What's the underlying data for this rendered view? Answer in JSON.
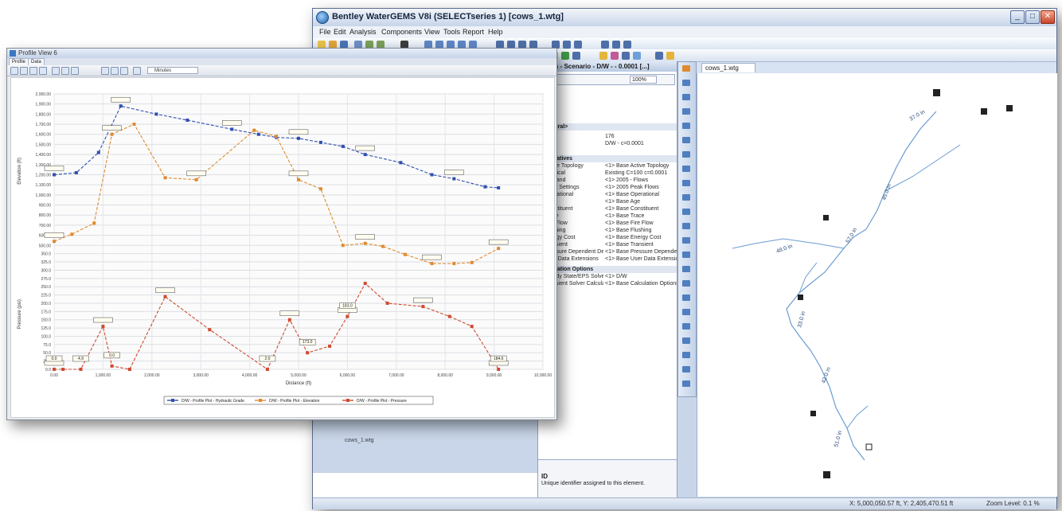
{
  "main_window": {
    "title": "Bentley WaterGEMS V8i (SELECTseries 1) [cows_1.wtg]",
    "menu": [
      "File",
      "Edit",
      "Analysis",
      "Components",
      "View",
      "Tools",
      "Report",
      "Help"
    ],
    "drawing_tab": "cows_1.wtg",
    "zoom_combo": "100%",
    "properties_title": "Pipes - Scenario - D/W - - 0.0001 [...]",
    "properties": {
      "general_header": "<General>",
      "id_value": "176",
      "label_value": "D/W - c=0.0001",
      "scenarios_header": "Alternatives",
      "rows": [
        {
          "name": "Active Topology",
          "value": "<1> Base Active Topology"
        },
        {
          "name": "Physical",
          "value": "Existing C=100 c=0.0001"
        },
        {
          "name": "Demand",
          "value": "<1> 2005 - Flows"
        },
        {
          "name": "Initial Settings",
          "value": "<1> 2005 Peak Flows"
        },
        {
          "name": "Operational",
          "value": "<1> Base Operational"
        },
        {
          "name": "Age",
          "value": "<1> Base Age"
        },
        {
          "name": "Constituent",
          "value": "<1> Base Constituent"
        },
        {
          "name": "Trace",
          "value": "<1> Base Trace"
        },
        {
          "name": "Fire Flow",
          "value": "<1> Base Fire Flow"
        },
        {
          "name": "Flushing",
          "value": "<1> Base Flushing"
        },
        {
          "name": "Energy Cost",
          "value": "<1> Base Energy Cost"
        },
        {
          "name": "Transient",
          "value": "<1> Base Transient"
        },
        {
          "name": "Pressure Dependent Dem",
          "value": "<1> Base Pressure Dependent D"
        },
        {
          "name": "User Data Extensions",
          "value": "<1> Base User Data Extensions"
        }
      ],
      "calc_header": "Calculation Options",
      "calc_rows": [
        {
          "name": "Steady State/EPS Solver",
          "value": "<1> D/W"
        },
        {
          "name": "Transient Solver Calculat",
          "value": "<1> Base Calculation Options"
        }
      ],
      "desc_title": "ID",
      "desc_text": "Unique identifier assigned to this element."
    },
    "left_pane_label": "cows_1.wtg",
    "status_coords": "X: 5,000,050.57 ft, Y: 2,405,470.51 ft",
    "status_zoom": "Zoom Level: 0.1 %",
    "network_labels": [
      "37.0 in",
      "45.0 in",
      "57.0 in",
      "48.0 in",
      "42.0 in",
      "33.0 in",
      "51.0 in"
    ]
  },
  "profile_window": {
    "title": "Profile View 6",
    "tabs": [
      "Profile",
      "Data"
    ],
    "zoom_box": "Minutes",
    "legend": [
      "D/W - Profile Plot - Hydraulic Grade",
      "D/W - Profile Plot - Elevation",
      "D/W - Profile Plot - Pressure"
    ]
  },
  "chart_data": {
    "type": "line",
    "xlabel": "Distance (ft)",
    "ylabel": "Elevation (ft)",
    "y2label": "Pressure (psi)",
    "xlim": [
      0,
      11000
    ],
    "ylim": [
      0,
      2000
    ],
    "x_ticks": [
      "0.00",
      "1,000.00",
      "2,000.00",
      "3,000.00",
      "4,000.00",
      "5,000.00",
      "6,000.00",
      "7,000.00",
      "8,000.00",
      "9,000.00",
      "10,000.00"
    ],
    "y_ticks": [
      "2,000.00",
      "1,900.00",
      "1,800.00",
      "1,700.00",
      "1,600.00",
      "1,500.00",
      "1,400.00",
      "1,300.00",
      "1,200.00",
      "1,100.00",
      "1,000.00",
      "900.00",
      "800.00",
      "700.00",
      "600.00",
      "500.00"
    ],
    "y2_ticks": [
      "350.0",
      "325.0",
      "300.0",
      "275.0",
      "250.0",
      "225.0",
      "200.0",
      "175.0",
      "150.0",
      "125.0",
      "100.0",
      "75.0",
      "50.0",
      "25.0",
      "0.0"
    ],
    "series": [
      {
        "name": "D/W - Profile Plot - Hydraulic Grade",
        "color": "#3050b0",
        "x": [
          0,
          500,
          1000,
          1500,
          2300,
          3000,
          4000,
          4600,
          5000,
          5500,
          6000,
          6500,
          7000,
          7800,
          8500,
          9000,
          9700,
          10000
        ],
        "y": [
          1200,
          1220,
          1420,
          1880,
          1800,
          1740,
          1650,
          1600,
          1570,
          1560,
          1520,
          1480,
          1400,
          1320,
          1200,
          1160,
          1080,
          1070
        ]
      },
      {
        "name": "D/W - Profile Plot - Elevation",
        "color": "#e08a30",
        "x": [
          0,
          400,
          900,
          1300,
          1800,
          2500,
          3200,
          4500,
          5000,
          5500,
          6000,
          6500,
          7000,
          7400,
          7900,
          8500,
          9000,
          9400,
          10000
        ],
        "y": [
          540,
          610,
          720,
          1600,
          1700,
          1170,
          1150,
          1640,
          1580,
          1150,
          1060,
          500,
          520,
          490,
          410,
          320,
          320,
          330,
          470
        ]
      },
      {
        "name": "D/W - Profile Plot - Pressure",
        "color": "#d04a30",
        "x": [
          0,
          200,
          600,
          1100,
          1300,
          1700,
          2500,
          3500,
          4800,
          5300,
          5700,
          6200,
          6600,
          7000,
          7500,
          8300,
          8900,
          9400,
          10000
        ],
        "y": [
          0,
          0,
          0,
          130,
          10,
          0,
          220,
          120,
          0,
          150,
          50,
          70,
          160,
          260,
          200,
          190,
          160,
          130,
          0
        ]
      }
    ],
    "data_labels": [
      "0.0",
      "4.9",
      "0.0",
      "2.0",
      "173.0",
      "183.0",
      "184.6"
    ]
  }
}
